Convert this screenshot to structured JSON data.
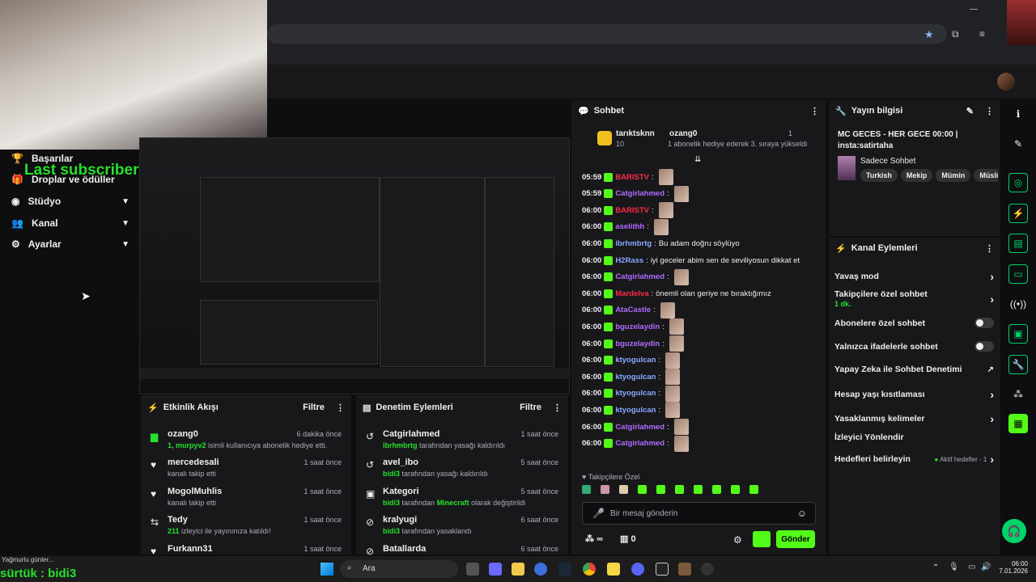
{
  "colors": {
    "accent": "#27e02d",
    "kick_green": "#53fc18",
    "bg": "#0e0e10",
    "panel": "#18181b"
  },
  "overlay": {
    "last_subscriber": "Last subscriber: HerkullTV",
    "bottom_overlay": "sürtük : bidi3"
  },
  "leftnav": {
    "items": [
      {
        "label": "Başarılar",
        "icon": "trophy-icon"
      },
      {
        "label": "Droplar ve ödüller",
        "icon": "gift-icon"
      },
      {
        "label": "Stüdyo",
        "icon": "studio-icon"
      },
      {
        "label": "Kanal",
        "icon": "users-icon"
      },
      {
        "label": "Ayarlar",
        "icon": "gear-icon"
      }
    ]
  },
  "activity": {
    "title": "Etkinlik Akışı",
    "filter": "Filtre",
    "rows": [
      {
        "name": "ozang0",
        "time": "6 dakika önce",
        "desc_bold": "1, murpyv2",
        "desc": " isimli kullanıcıya abonelik hediye etti.",
        "icon": "gift-icon"
      },
      {
        "name": "mercedesali",
        "time": "1 saat önce",
        "desc_bold": "",
        "desc": "kanalı takip etti",
        "icon": "heart-icon"
      },
      {
        "name": "MogolMuhlis",
        "time": "1 saat önce",
        "desc_bold": "",
        "desc": "kanalı takip etti",
        "icon": "heart-icon"
      },
      {
        "name": "Tedy",
        "time": "1 saat önce",
        "desc_bold": "211",
        "desc": " izleyici ile yayınınıza katıldı!",
        "icon": "raid-icon"
      },
      {
        "name": "Furkann31",
        "time": "1 saat önce",
        "desc_bold": "",
        "desc": "",
        "icon": "heart-icon"
      }
    ]
  },
  "moderation": {
    "title": "Denetim Eylemleri",
    "filter": "Filtre",
    "rows": [
      {
        "name": "Catgirlahmed",
        "time": "1 saat önce",
        "desc_bold": "ibrhmbrtg",
        "desc": " tarafından yasağı kaldırıldı",
        "icon": "unban-icon"
      },
      {
        "name": "avel_ibo",
        "time": "5 saat önce",
        "desc_bold": "bidi3",
        "desc": " tarafından yasağı kaldırıldı",
        "icon": "unban-icon"
      },
      {
        "name": "Kategori",
        "time": "5 saat önce",
        "desc_bold": "bidi3",
        "desc": " tarafından ",
        "desc_bold2": "Minecraft",
        "desc2": " olarak değiştirildi",
        "icon": "category-icon"
      },
      {
        "name": "kralyugi",
        "time": "6 saat önce",
        "desc_bold": "bidi3",
        "desc": " tarafından yasaklandı",
        "icon": "ban-icon"
      },
      {
        "name": "Batallarda",
        "time": "6 saat önce",
        "desc_bold": "",
        "desc": "",
        "icon": "ban-icon"
      }
    ]
  },
  "chat": {
    "title": "Sohbet",
    "pinned": {
      "user1": "tarıktsknn",
      "user1_count": "10",
      "user2": "ozang0",
      "user2_count": "1",
      "note": "1 abonelik hediye ederek 3. sıraya yükseldi"
    },
    "messages": [
      {
        "time": "05:59",
        "user": "BARISTV",
        "color": "#ff2b48",
        "text": "",
        "emote": true
      },
      {
        "time": "05:59",
        "user": "Catgirlahmed",
        "color": "#b06cff",
        "text": "",
        "emote": true
      },
      {
        "time": "06:00",
        "user": "BARISTV",
        "color": "#ff2b48",
        "text": "",
        "emote": true
      },
      {
        "time": "06:00",
        "user": "aselithh",
        "color": "#b06cff",
        "text": "",
        "emote": true
      },
      {
        "time": "06:00",
        "user": "ibrhmbrtg",
        "color": "#8aa8ff",
        "text": "Bu adam doğru söylüyo",
        "emote": false
      },
      {
        "time": "06:00",
        "user": "H2Rass",
        "color": "#8aa8ff",
        "text": "iyi geceler abim sen de seviliyosun dikkat et",
        "emote": false
      },
      {
        "time": "06:00",
        "user": "Catgirlahmed",
        "color": "#b06cff",
        "text": "",
        "emote": true
      },
      {
        "time": "06:00",
        "user": "Mardelva",
        "color": "#ff2b48",
        "text": "önemli olan geriye ne bıraktığımız",
        "emote": false
      },
      {
        "time": "06:00",
        "user": "AtaCastle",
        "color": "#b06cff",
        "text": "",
        "emote": true
      },
      {
        "time": "06:00",
        "user": "bguzelaydin",
        "color": "#b06cff",
        "text": "",
        "emote": true
      },
      {
        "time": "06:00",
        "user": "bguzelaydin",
        "color": "#b06cff",
        "text": "",
        "emote": true
      },
      {
        "time": "06:00",
        "user": "ktyogulcan",
        "color": "#8aa8ff",
        "text": "",
        "emote": true
      },
      {
        "time": "06:00",
        "user": "ktyogulcan",
        "color": "#8aa8ff",
        "text": "",
        "emote": true
      },
      {
        "time": "06:00",
        "user": "ktyogulcan",
        "color": "#8aa8ff",
        "text": "",
        "emote": true
      },
      {
        "time": "06:00",
        "user": "ktyogulcan",
        "color": "#8aa8ff",
        "text": "",
        "emote": true
      },
      {
        "time": "06:00",
        "user": "Catgirlahmed",
        "color": "#b06cff",
        "text": "",
        "emote": true
      },
      {
        "time": "06:00",
        "user": "Catgirlahmed",
        "color": "#b06cff",
        "text": "",
        "emote": true
      }
    ],
    "followers_only": "Takipçilere Özel",
    "input_placeholder": "Bir mesaj gönderin",
    "points": "∞",
    "gifts": "0",
    "send": "Gönder"
  },
  "info": {
    "title": "Yayın bilgisi",
    "stream_title": "MC GECES - HER GECE 00:00 | insta:satirtaha",
    "category": "Sadece Sohbet",
    "tags": [
      "Turkish",
      "Mekip",
      "Mümin",
      "Müslüm"
    ]
  },
  "actions": {
    "title": "Kanal Eylemleri",
    "rows": [
      {
        "label": "Yavaş mod",
        "type": "chevron"
      },
      {
        "label": "Takipçilere özel sohbet",
        "sub": "1 dk.",
        "type": "chevron"
      },
      {
        "label": "Abonelere özel sohbet",
        "type": "toggle"
      },
      {
        "label": "Yalnızca ifadelerle sohbet",
        "type": "toggle"
      },
      {
        "label": "Yapay Zeka ile Sohbet Denetimi",
        "type": "external"
      },
      {
        "label": "Hesap yaşı kısıtlaması",
        "type": "chevron"
      },
      {
        "label": "Yasaklanmış kelimeler",
        "type": "chevron"
      },
      {
        "label": "İzleyici Yönlendir",
        "type": "none"
      },
      {
        "label": "Hedefleri belirleyin",
        "type": "goal",
        "status": "Aktif hedefler - 1"
      }
    ]
  },
  "taskbar": {
    "search": "Ara",
    "notification": "Yağmurlu günler...",
    "time": "06:00",
    "date": "7.01.2026"
  }
}
